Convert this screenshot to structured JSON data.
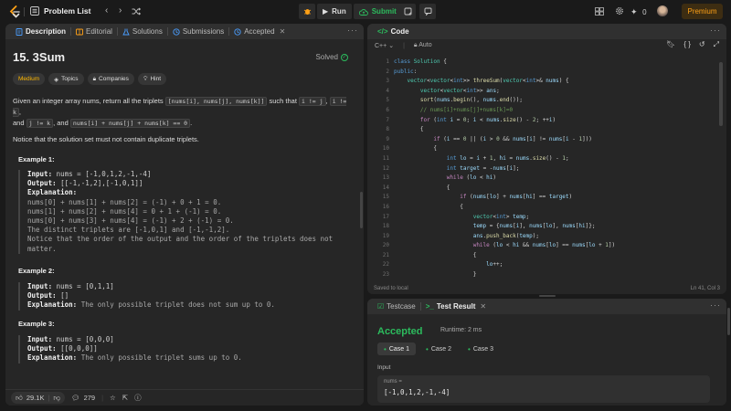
{
  "topbar": {
    "title": "Problem List",
    "run_label": "Run",
    "submit_label": "Submit",
    "streak_count": "0",
    "premium_label": "Premium"
  },
  "left_tabs": {
    "description": "Description",
    "editorial": "Editorial",
    "solutions": "Solutions",
    "submissions": "Submissions",
    "accepted": "Accepted"
  },
  "problem": {
    "title": "15. 3Sum",
    "status": "Solved",
    "tags": {
      "difficulty": "Medium",
      "topics": "Topics",
      "companies": "Companies",
      "hint": "Hint"
    },
    "statement": {
      "p1a": "Given an integer array nums, return all the triplets ",
      "c1": "[nums[i], nums[j], nums[k]]",
      "p1b": " such that ",
      "c2": "i != j",
      "p1c": ", ",
      "c3": "i != k",
      "p1d": ",",
      "p1e": "and ",
      "c4": "j != k",
      "p1f": ", and ",
      "c5": "nums[i] + nums[j] + nums[k] == 0",
      "p1g": ".",
      "p2": "Notice that the solution set must not contain duplicate triplets."
    },
    "examples": [
      {
        "title": "Example 1:",
        "input_label": "Input:",
        "input": " nums = [-1,0,1,2,-1,-4]",
        "output_label": "Output:",
        "output": " [[-1,-1,2],[-1,0,1]]",
        "explanation_label": "Explanation:",
        "explanation": "nums[0] + nums[1] + nums[2] = (-1) + 0 + 1 = 0.\nnums[1] + nums[2] + nums[4] = 0 + 1 + (-1) = 0.\nnums[0] + nums[3] + nums[4] = (-1) + 2 + (-1) = 0.\nThe distinct triplets are [-1,0,1] and [-1,-1,2].\nNotice that the order of the output and the order of the triplets does not\nmatter."
      },
      {
        "title": "Example 2:",
        "input_label": "Input:",
        "input": " nums = [0,1,1]",
        "output_label": "Output:",
        "output": " []",
        "explanation_label": "Explanation:",
        "explanation": " The only possible triplet does not sum up to 0."
      },
      {
        "title": "Example 3:",
        "input_label": "Input:",
        "input": " nums = [0,0,0]",
        "output_label": "Output:",
        "output": " [[0,0,0]]",
        "explanation_label": "Explanation:",
        "explanation": " The only possible triplet sums up to 0."
      }
    ],
    "likes": "29.1K",
    "comments": "279"
  },
  "code_panel": {
    "title": "Code",
    "language": "C++",
    "mode": "Auto",
    "saved": "Saved to local",
    "cursor": "Ln 41, Col 3",
    "line_numbers": [
      "1",
      "2",
      "3",
      "4",
      "5",
      "6",
      "7",
      "8",
      "9",
      "10",
      "11",
      "12",
      "13",
      "14",
      "15",
      "16",
      "17",
      "18",
      "19",
      "20",
      "21",
      "22",
      "23"
    ]
  },
  "test_panel": {
    "testcase_tab": "Testcase",
    "result_tab": "Test Result",
    "status": "Accepted",
    "runtime": "Runtime: 2 ms",
    "cases": [
      "Case 1",
      "Case 2",
      "Case 3"
    ],
    "input_label": "Input",
    "input_var": "nums =",
    "input_value": "[-1,0,1,2,-1,-4]"
  },
  "colors": {
    "accent": "#ffa116",
    "success": "#2cbb5d",
    "medium": "#ffb800",
    "bg": "#1a1a1a",
    "panel": "#262626"
  }
}
